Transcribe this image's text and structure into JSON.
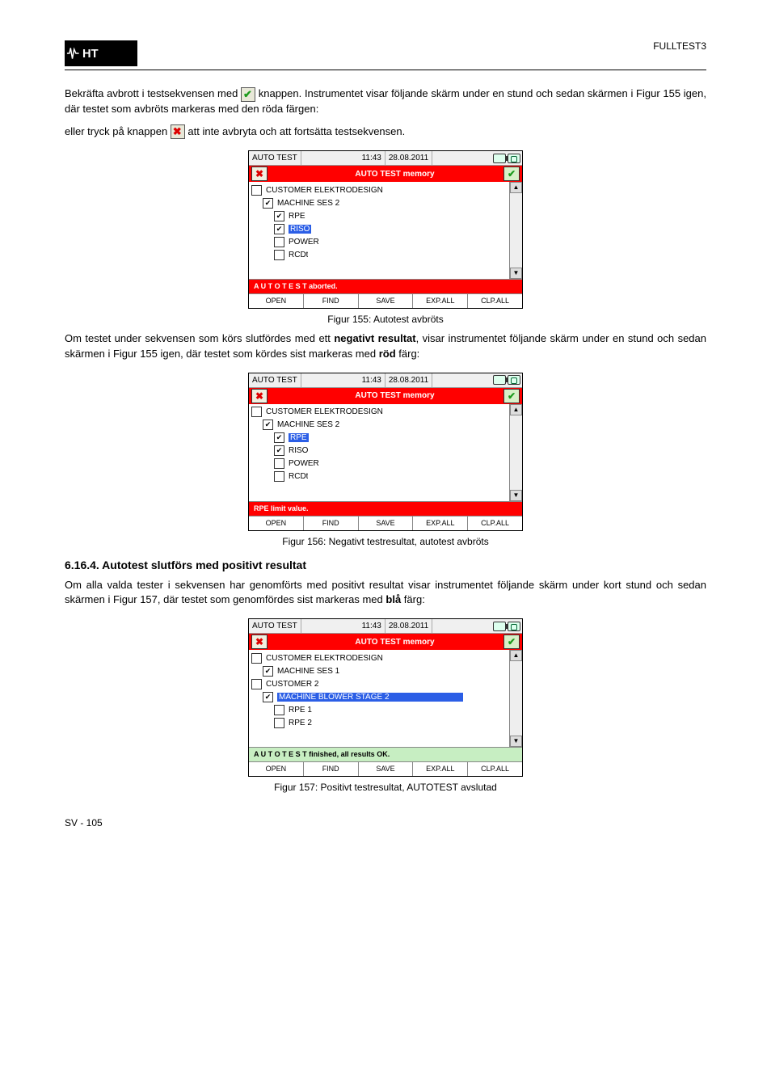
{
  "header": {
    "device_label": "FULLTEST3"
  },
  "para1_before": "Bekräfta avbrott i testsekvensen med ",
  "para1_after": " knappen. Instrumentet visar följande skärm under en stund och sedan skärmen i Figur 155 igen, där testet som avbröts markeras med den röda färgen:",
  "para2_before": "eller tryck på knappen ",
  "para2_after": " att inte avbryta och att fortsätta testsekvensen.",
  "screen1": {
    "titlebar_left": "AUTO TEST",
    "titlebar_time": "11:43",
    "titlebar_date": "28.08.2011",
    "redbar_title": "AUTO TEST memory",
    "rows": [
      {
        "level": 1,
        "checked": false,
        "label": "CUSTOMER ELEKTRODESIGN",
        "selected": false
      },
      {
        "level": 2,
        "checked": true,
        "label": "MACHINE SES 2",
        "selected": false
      },
      {
        "level": 3,
        "checked": true,
        "label": "RPE",
        "selected": false
      },
      {
        "level": 3,
        "checked": true,
        "label": "RISO",
        "selected": true
      },
      {
        "level": 3,
        "checked": false,
        "label": "POWER",
        "selected": false
      },
      {
        "level": 3,
        "checked": false,
        "label": "RCDt",
        "selected": false
      }
    ],
    "status": "A U T O    T E S T    aborted.",
    "tabs": [
      "OPEN",
      "FIND",
      "SAVE",
      "EXP.ALL",
      "CLP.ALL"
    ]
  },
  "fig1": "Figur 155: Autotest avbröts",
  "para3_before": "Om testet under sekvensen som körs slutfördes med ett ",
  "para3_mid1": "negativt resultat",
  "para3_mid2": ", visar instrumentet följande skärm under en stund och sedan skärmen i Figur 155 igen, där testet som kördes sist markeras med ",
  "para3_color": "röd",
  "para3_after": " färg:",
  "screen2": {
    "titlebar_left": "AUTO TEST",
    "titlebar_time": "11:43",
    "titlebar_date": "28.08.2011",
    "redbar_title": "AUTO TEST memory",
    "rows": [
      {
        "level": 1,
        "checked": false,
        "label": "CUSTOMER ELEKTRODESIGN",
        "selected": false
      },
      {
        "level": 2,
        "checked": true,
        "label": "MACHINE SES 2",
        "selected": false
      },
      {
        "level": 3,
        "checked": true,
        "label": "RPE",
        "selected": true
      },
      {
        "level": 3,
        "checked": true,
        "label": "RISO",
        "selected": false
      },
      {
        "level": 3,
        "checked": false,
        "label": "POWER",
        "selected": false
      },
      {
        "level": 3,
        "checked": false,
        "label": "RCDt",
        "selected": false
      }
    ],
    "status": "RPE    limit value.",
    "tabs": [
      "OPEN",
      "FIND",
      "SAVE",
      "EXP.ALL",
      "CLP.ALL"
    ]
  },
  "fig2": "Figur 156: Negativt testresultat, autotest avbröts",
  "section_heading": "6.16.4. Autotest slutförs med positivt resultat",
  "para4_before": "Om alla valda tester i sekvensen har genomförts med positivt resultat visar instrumentet följande skärm under kort stund och sedan skärmen i Figur 157, där testet som genomfördes sist markeras med ",
  "para4_color": "blå",
  "para4_after": " färg:",
  "screen3": {
    "titlebar_left": "AUTO TEST",
    "titlebar_time": "11:43",
    "titlebar_date": "28.08.2011",
    "redbar_title": "AUTO TEST memory",
    "rows": [
      {
        "level": 1,
        "checked": false,
        "label": "CUSTOMER ELEKTRODESIGN",
        "selected": false
      },
      {
        "level": 2,
        "checked": true,
        "label": "MACHINE SES 1",
        "selected": false
      },
      {
        "level": 1,
        "checked": false,
        "label": "CUSTOMER 2",
        "selected": false
      },
      {
        "level": 2,
        "checked": true,
        "label": "MACHINE BLOWER STAGE 2",
        "selected": true
      },
      {
        "level": 3,
        "checked": false,
        "label": "RPE 1",
        "selected": false
      },
      {
        "level": 3,
        "checked": false,
        "label": "RPE 2",
        "selected": false
      }
    ],
    "status": "A U T O    T E S T    finished, all results OK.",
    "tabs": [
      "OPEN",
      "FIND",
      "SAVE",
      "EXP.ALL",
      "CLP.ALL"
    ]
  },
  "fig3": "Figur 157: Positivt testresultat, AUTOTEST avslutad",
  "footer": {
    "left": "SV - 105",
    "right": ""
  }
}
